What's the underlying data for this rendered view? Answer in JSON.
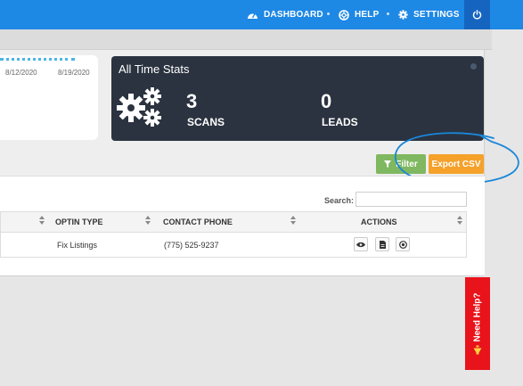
{
  "nav": {
    "dashboard": "DASHBOARD",
    "help": "HELP",
    "settings": "SETTINGS"
  },
  "chart": {
    "dates": [
      "8/12/2020",
      "8/19/2020"
    ]
  },
  "stats": {
    "title": "All Time Stats",
    "scans_value": "3",
    "scans_label": "SCANS",
    "leads_value": "0",
    "leads_label": "LEADS"
  },
  "actions": {
    "filter": "Filter",
    "export": "Export CSV"
  },
  "table": {
    "search_label": "Search:",
    "search_value": "",
    "headers": [
      "OPTIN TYPE",
      "CONTACT PHONE",
      "ACTIONS"
    ],
    "rows": [
      {
        "optin_type": "Fix Listings",
        "contact_phone": "(775) 525-9237"
      }
    ]
  },
  "help_tab": "Need Help?",
  "colors": {
    "topbar": "#1e88e5",
    "stats_bg": "#2b3340",
    "filter": "#7fb860",
    "export": "#f5a12a",
    "help": "#e8131b",
    "annotation": "#1a86d8"
  }
}
